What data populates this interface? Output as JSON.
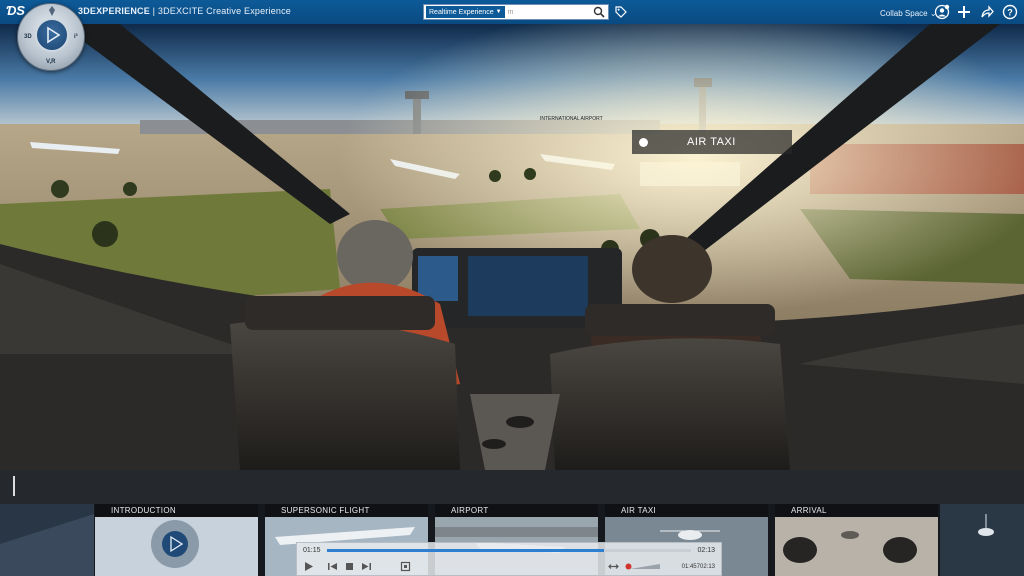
{
  "app": {
    "brand_prefix": "3DEXPERIENCE",
    "brand_suffix": " | 3DEXCITE Creative Experience"
  },
  "search": {
    "scope": "Realtime Experience",
    "placeholder": "",
    "value": "m"
  },
  "header": {
    "collab_space": "Collab Space"
  },
  "compass": {
    "left": "3D",
    "right": "i³",
    "bottom": "V,R"
  },
  "scene": {
    "label": "AIR TAXI",
    "airport_sign": "INTERNATIONAL AIRPORT"
  },
  "chapters": [
    {
      "title": "INTRODUCTION"
    },
    {
      "title": "SUPERSONIC FLIGHT"
    },
    {
      "title": "AIRPORT"
    },
    {
      "title": "AIR TAXI"
    },
    {
      "title": "ARRIVAL"
    }
  ],
  "player": {
    "current_time": "01:15",
    "total_time": "02:13",
    "progress": 0.76,
    "timecode": "01:45702:13"
  },
  "colors": {
    "topbar": "#0d5a98",
    "progress": "#2f7fd1"
  }
}
